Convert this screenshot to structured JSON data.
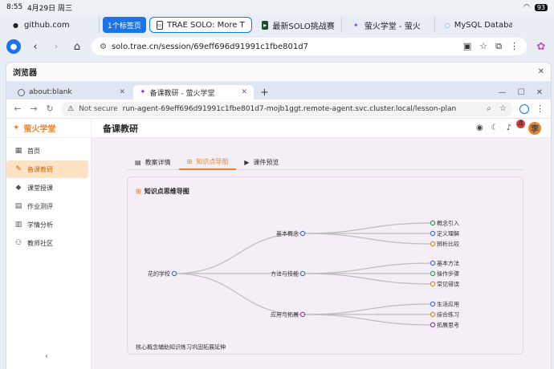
{
  "status": {
    "time": "8:55",
    "date": "4月29日 周三",
    "battery": "93"
  },
  "outer_tabs": [
    {
      "label": "github.com",
      "icon": "github-icon"
    },
    {
      "label": "1个标签页",
      "pill": true
    },
    {
      "label": "TRAE SOLO: More T",
      "icon": "trae-icon",
      "active": true
    },
    {
      "label": "最新SOLO挑战赛",
      "icon": "terminal-icon"
    },
    {
      "label": "萤火学堂 - 萤火",
      "icon": "firefly-icon"
    },
    {
      "label": "MySQL Databas",
      "icon": "loading-icon"
    }
  ],
  "outer_url": "solo.trae.cn/session/69eff696d91991c1fbe801d7",
  "window": {
    "title": "浏览器",
    "close": "✕"
  },
  "inner_tabs": [
    {
      "label": "about:blank",
      "icon": "globe-icon"
    },
    {
      "label": "备课教研 - 萤火学堂",
      "icon": "firefly-icon",
      "active": true
    }
  ],
  "inner_url": {
    "security": "Not secure",
    "url": "run-agent-69eff696d91991c1fbe801d7-mojb1ggt.remote-agent.svc.cluster.local/lesson-plan"
  },
  "app": {
    "brand": "萤火学堂",
    "page_title": "备课教研",
    "notification_count": "4",
    "avatar_initial": "李",
    "nav": [
      {
        "label": "首页",
        "icon": "home-icon"
      },
      {
        "label": "备课教研",
        "icon": "edit-icon",
        "active": true
      },
      {
        "label": "课堂授课",
        "icon": "graduation-icon"
      },
      {
        "label": "作业测评",
        "icon": "assignment-icon"
      },
      {
        "label": "学情分析",
        "icon": "chart-icon"
      },
      {
        "label": "教师社区",
        "icon": "community-icon"
      }
    ],
    "tabs": [
      {
        "label": "教案详情",
        "icon": "doc-icon"
      },
      {
        "label": "知识点导图",
        "icon": "mindmap-icon",
        "active": true
      },
      {
        "label": "课件预览",
        "icon": "video-icon"
      }
    ],
    "card_title": "知识点思维导图",
    "caption": "核心概念辅助知识练习巩固拓展延伸",
    "mindmap": {
      "root": {
        "label": "花的学校",
        "color": "#3b6fd8"
      },
      "branches": [
        {
          "label": "基本概念",
          "color": "#3b6fd8",
          "leaves": [
            {
              "label": "概念引入",
              "color": "#2e9e4f"
            },
            {
              "label": "定义理解",
              "color": "#3b6fd8"
            },
            {
              "label": "辨析比较",
              "color": "#e8822e"
            }
          ]
        },
        {
          "label": "方法与技能",
          "color": "#3b6fd8",
          "leaves": [
            {
              "label": "基本方法",
              "color": "#3b6fd8"
            },
            {
              "label": "操作步骤",
              "color": "#2e9e4f"
            },
            {
              "label": "常见错误",
              "color": "#e8822e"
            }
          ]
        },
        {
          "label": "应用与拓展",
          "color": "#8e3fb0",
          "leaves": [
            {
              "label": "生活应用",
              "color": "#3b6fd8"
            },
            {
              "label": "综合练习",
              "color": "#e8822e"
            },
            {
              "label": "拓展思考",
              "color": "#8e3fb0"
            }
          ]
        }
      ]
    }
  }
}
